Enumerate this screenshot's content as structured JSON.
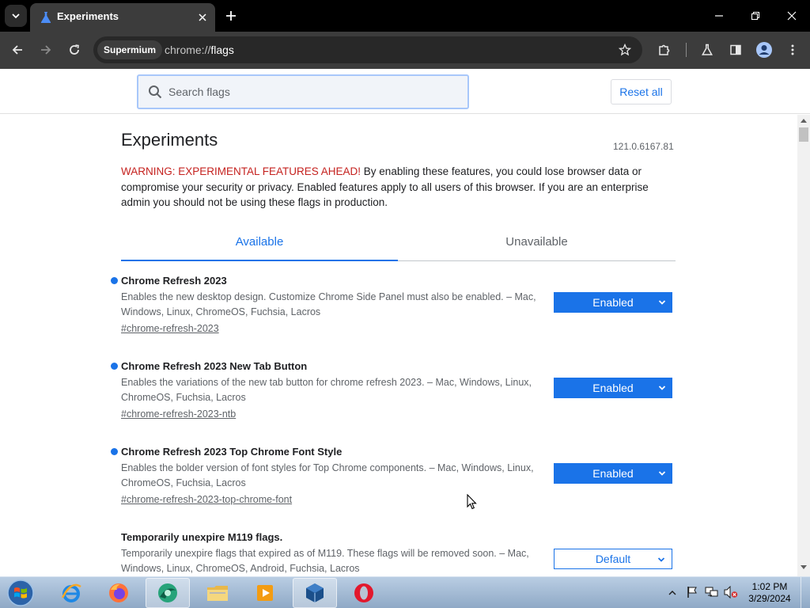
{
  "browser": {
    "tab": {
      "title": "Experiments",
      "favicon": "flask-icon"
    },
    "omnibox": {
      "site_chip": "Supermium",
      "url_scheme": "chrome://",
      "url_host": "flags"
    }
  },
  "header": {
    "search_placeholder": "Search flags",
    "reset_label": "Reset all"
  },
  "page": {
    "title": "Experiments",
    "version": "121.0.6167.81",
    "warning_prefix": "WARNING: EXPERIMENTAL FEATURES AHEAD!",
    "warning_body": " By enabling these features, you could lose browser data or compromise your security or privacy. Enabled features apply to all users of this browser. If you are an enterprise admin you should not be using these flags in production.",
    "tabs": [
      {
        "label": "Available",
        "selected": true
      },
      {
        "label": "Unavailable",
        "selected": false
      }
    ],
    "flags": [
      {
        "title": "Chrome Refresh 2023",
        "description": "Enables the new desktop design. Customize Chrome Side Panel must also be enabled. – Mac, Windows, Linux, ChromeOS, Fuchsia, Lacros",
        "link": "#chrome-refresh-2023",
        "value": "Enabled",
        "modified": true
      },
      {
        "title": "Chrome Refresh 2023 New Tab Button",
        "description": "Enables the variations of the new tab button for chrome refresh 2023. – Mac, Windows, Linux, ChromeOS, Fuchsia, Lacros",
        "link": "#chrome-refresh-2023-ntb",
        "value": "Enabled",
        "modified": true
      },
      {
        "title": "Chrome Refresh 2023 Top Chrome Font Style",
        "description": "Enables the bolder version of font styles for Top Chrome components. – Mac, Windows, Linux, ChromeOS, Fuchsia, Lacros",
        "link": "#chrome-refresh-2023-top-chrome-font",
        "value": "Enabled",
        "modified": true
      },
      {
        "title": "Temporarily unexpire M119 flags.",
        "description": "Temporarily unexpire flags that expired as of M119. These flags will be removed soon. – Mac, Windows, Linux, ChromeOS, Android, Fuchsia, Lacros",
        "value": "Default",
        "modified": false
      }
    ]
  },
  "taskbar": {
    "apps": [
      "internet-explorer-icon",
      "firefox-icon",
      "supermium-icon",
      "file-explorer-icon",
      "media-player-icon",
      "virtualbox-icon",
      "opera-icon"
    ],
    "clock_time": "1:02 PM",
    "clock_date": "3/29/2024"
  },
  "colors": {
    "accent": "#1a73e8",
    "warning": "#c5221f",
    "titlebar": "#000000",
    "toolbar": "#3c3c3c"
  }
}
